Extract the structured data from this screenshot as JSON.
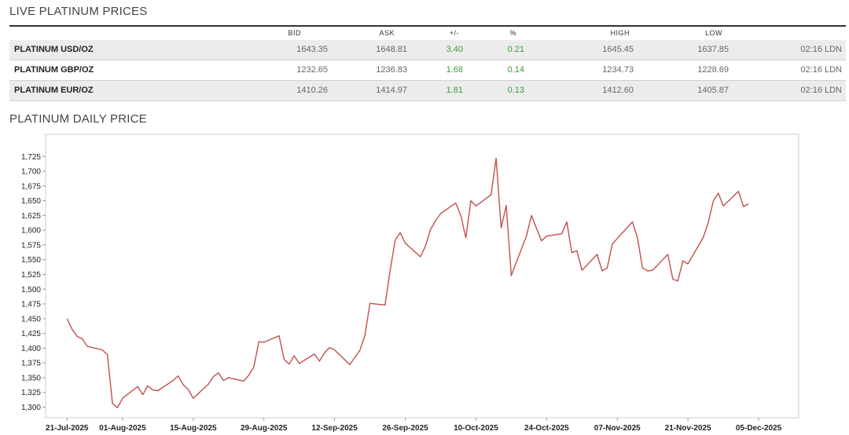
{
  "live_section": {
    "title": "LIVE PLATINUM PRICES",
    "columns": {
      "bid": "BID",
      "ask": "ASK",
      "change": "+/-",
      "percent": "%",
      "high": "HIGH",
      "low": "LOW"
    },
    "rows": [
      {
        "name": "PLATINUM USD/OZ",
        "bid": "1643.35",
        "ask": "1648.81",
        "change": "3.40",
        "percent": "0.21",
        "high": "1645.45",
        "low": "1637.85",
        "time": "02:16 LDN"
      },
      {
        "name": "PLATINUM GBP/OZ",
        "bid": "1232.65",
        "ask": "1236.83",
        "change": "1.68",
        "percent": "0.14",
        "high": "1234.73",
        "low": "1228.69",
        "time": "02:16 LDN"
      },
      {
        "name": "PLATINUM EUR/OZ",
        "bid": "1410.26",
        "ask": "1414.97",
        "change": "1.81",
        "percent": "0.13",
        "high": "1412.60",
        "low": "1405.87",
        "time": "02:16 LDN"
      }
    ],
    "colors": {
      "positive": "#3e9a3e",
      "row_shade": "#ececec"
    }
  },
  "daily_section": {
    "title": "PLATINUM DAILY PRICE"
  },
  "chart_data": {
    "type": "line",
    "title": "",
    "xlabel": "",
    "ylabel": "",
    "line_color": "#c0504d",
    "grid": false,
    "legend": "none",
    "ylim": [
      1290,
      1740
    ],
    "y_ticks": [
      "1,300",
      "1,325",
      "1,350",
      "1,375",
      "1,400",
      "1,425",
      "1,450",
      "1,475",
      "1,500",
      "1,525",
      "1,550",
      "1,575",
      "1,600",
      "1,625",
      "1,650",
      "1,675",
      "1,700",
      "1,725"
    ],
    "y_tick_values": [
      1300,
      1325,
      1350,
      1375,
      1400,
      1425,
      1450,
      1475,
      1500,
      1525,
      1550,
      1575,
      1600,
      1625,
      1650,
      1675,
      1700,
      1725
    ],
    "x_ticks": [
      "21-Jul-2025",
      "01-Aug-2025",
      "15-Aug-2025",
      "29-Aug-2025",
      "12-Sep-2025",
      "26-Sep-2025",
      "10-Oct-2025",
      "24-Oct-2025",
      "07-Nov-2025",
      "21-Nov-2025",
      "05-Dec-2025"
    ],
    "x_tick_dates": [
      "2025-07-21",
      "2025-08-01",
      "2025-08-15",
      "2025-08-29",
      "2025-09-12",
      "2025-09-26",
      "2025-10-10",
      "2025-10-24",
      "2025-11-07",
      "2025-11-21",
      "2025-12-05"
    ],
    "x_range": [
      "2025-07-18",
      "2025-12-12"
    ],
    "points": [
      {
        "x": "2025-07-21",
        "y": 1450
      },
      {
        "x": "2025-07-22",
        "y": 1432
      },
      {
        "x": "2025-07-23",
        "y": 1420
      },
      {
        "x": "2025-07-24",
        "y": 1416
      },
      {
        "x": "2025-07-25",
        "y": 1403
      },
      {
        "x": "2025-07-28",
        "y": 1397
      },
      {
        "x": "2025-07-29",
        "y": 1389
      },
      {
        "x": "2025-07-30",
        "y": 1306
      },
      {
        "x": "2025-07-31",
        "y": 1299
      },
      {
        "x": "2025-08-01",
        "y": 1315
      },
      {
        "x": "2025-08-04",
        "y": 1335
      },
      {
        "x": "2025-08-05",
        "y": 1321
      },
      {
        "x": "2025-08-06",
        "y": 1336
      },
      {
        "x": "2025-08-07",
        "y": 1329
      },
      {
        "x": "2025-08-08",
        "y": 1328
      },
      {
        "x": "2025-08-11",
        "y": 1345
      },
      {
        "x": "2025-08-12",
        "y": 1353
      },
      {
        "x": "2025-08-13",
        "y": 1338
      },
      {
        "x": "2025-08-14",
        "y": 1330
      },
      {
        "x": "2025-08-15",
        "y": 1315
      },
      {
        "x": "2025-08-18",
        "y": 1339
      },
      {
        "x": "2025-08-19",
        "y": 1352
      },
      {
        "x": "2025-08-20",
        "y": 1358
      },
      {
        "x": "2025-08-21",
        "y": 1345
      },
      {
        "x": "2025-08-22",
        "y": 1350
      },
      {
        "x": "2025-08-25",
        "y": 1344
      },
      {
        "x": "2025-08-26",
        "y": 1354
      },
      {
        "x": "2025-08-27",
        "y": 1368
      },
      {
        "x": "2025-08-28",
        "y": 1411
      },
      {
        "x": "2025-08-29",
        "y": 1410
      },
      {
        "x": "2025-09-01",
        "y": 1421
      },
      {
        "x": "2025-09-02",
        "y": 1381
      },
      {
        "x": "2025-09-03",
        "y": 1373
      },
      {
        "x": "2025-09-04",
        "y": 1387
      },
      {
        "x": "2025-09-05",
        "y": 1374
      },
      {
        "x": "2025-09-08",
        "y": 1390
      },
      {
        "x": "2025-09-09",
        "y": 1378
      },
      {
        "x": "2025-09-10",
        "y": 1392
      },
      {
        "x": "2025-09-11",
        "y": 1401
      },
      {
        "x": "2025-09-12",
        "y": 1397
      },
      {
        "x": "2025-09-15",
        "y": 1372
      },
      {
        "x": "2025-09-16",
        "y": 1384
      },
      {
        "x": "2025-09-17",
        "y": 1396
      },
      {
        "x": "2025-09-18",
        "y": 1421
      },
      {
        "x": "2025-09-19",
        "y": 1476
      },
      {
        "x": "2025-09-22",
        "y": 1473
      },
      {
        "x": "2025-09-23",
        "y": 1532
      },
      {
        "x": "2025-09-24",
        "y": 1583
      },
      {
        "x": "2025-09-25",
        "y": 1596
      },
      {
        "x": "2025-09-26",
        "y": 1578
      },
      {
        "x": "2025-09-29",
        "y": 1555
      },
      {
        "x": "2025-09-30",
        "y": 1573
      },
      {
        "x": "2025-10-01",
        "y": 1601
      },
      {
        "x": "2025-10-02",
        "y": 1616
      },
      {
        "x": "2025-10-03",
        "y": 1628
      },
      {
        "x": "2025-10-06",
        "y": 1646
      },
      {
        "x": "2025-10-07",
        "y": 1625
      },
      {
        "x": "2025-10-08",
        "y": 1587
      },
      {
        "x": "2025-10-09",
        "y": 1650
      },
      {
        "x": "2025-10-10",
        "y": 1641
      },
      {
        "x": "2025-10-13",
        "y": 1660
      },
      {
        "x": "2025-10-14",
        "y": 1722
      },
      {
        "x": "2025-10-15",
        "y": 1604
      },
      {
        "x": "2025-10-16",
        "y": 1642
      },
      {
        "x": "2025-10-17",
        "y": 1523
      },
      {
        "x": "2025-10-20",
        "y": 1590
      },
      {
        "x": "2025-10-21",
        "y": 1625
      },
      {
        "x": "2025-10-22",
        "y": 1603
      },
      {
        "x": "2025-10-23",
        "y": 1582
      },
      {
        "x": "2025-10-24",
        "y": 1590
      },
      {
        "x": "2025-10-27",
        "y": 1594
      },
      {
        "x": "2025-10-28",
        "y": 1614
      },
      {
        "x": "2025-10-29",
        "y": 1562
      },
      {
        "x": "2025-10-30",
        "y": 1565
      },
      {
        "x": "2025-10-31",
        "y": 1532
      },
      {
        "x": "2025-11-03",
        "y": 1559
      },
      {
        "x": "2025-11-04",
        "y": 1531
      },
      {
        "x": "2025-11-05",
        "y": 1536
      },
      {
        "x": "2025-11-06",
        "y": 1576
      },
      {
        "x": "2025-11-07",
        "y": 1586
      },
      {
        "x": "2025-11-10",
        "y": 1614
      },
      {
        "x": "2025-11-11",
        "y": 1587
      },
      {
        "x": "2025-11-12",
        "y": 1536
      },
      {
        "x": "2025-11-13",
        "y": 1531
      },
      {
        "x": "2025-11-14",
        "y": 1532
      },
      {
        "x": "2025-11-17",
        "y": 1559
      },
      {
        "x": "2025-11-18",
        "y": 1517
      },
      {
        "x": "2025-11-19",
        "y": 1514
      },
      {
        "x": "2025-11-20",
        "y": 1548
      },
      {
        "x": "2025-11-21",
        "y": 1543
      },
      {
        "x": "2025-11-24",
        "y": 1587
      },
      {
        "x": "2025-11-25",
        "y": 1612
      },
      {
        "x": "2025-11-26",
        "y": 1649
      },
      {
        "x": "2025-11-27",
        "y": 1663
      },
      {
        "x": "2025-11-28",
        "y": 1641
      },
      {
        "x": "2025-12-01",
        "y": 1666
      },
      {
        "x": "2025-12-02",
        "y": 1640
      },
      {
        "x": "2025-12-03",
        "y": 1645
      }
    ]
  }
}
